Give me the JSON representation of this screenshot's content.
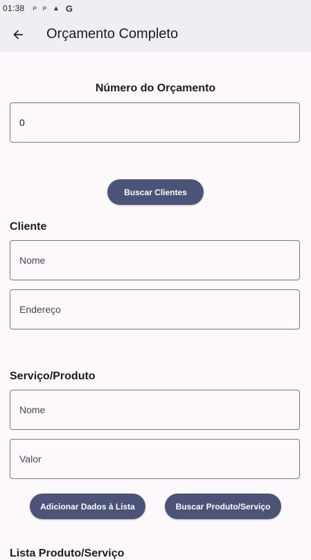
{
  "status_bar": {
    "time": "01:38",
    "icons": [
      "notification-p-icon",
      "notification-p-icon",
      "notification-a-icon",
      "google-icon"
    ]
  },
  "app_bar": {
    "title": "Orçamento Completo",
    "back_icon": "arrow-back-icon"
  },
  "budget_number": {
    "label": "Número do Orçamento",
    "value": "0"
  },
  "buttons": {
    "search_clients": "Buscar Clientes",
    "add_to_list": "Adicionar Dados à Lista",
    "search_product_service": "Buscar Produto/Serviço"
  },
  "client": {
    "label": "Cliente",
    "name_placeholder": "Nome",
    "address_placeholder": "Endereço"
  },
  "service_product": {
    "label": "Serviço/Produto",
    "name_placeholder": "Nome",
    "value_placeholder": "Valor"
  },
  "list_section": {
    "label": "Lista Produto/Serviço"
  },
  "colors": {
    "background": "#fdf8fc",
    "app_bar": "#f1eef3",
    "button": "#4b5478",
    "border": "#7a7680"
  }
}
